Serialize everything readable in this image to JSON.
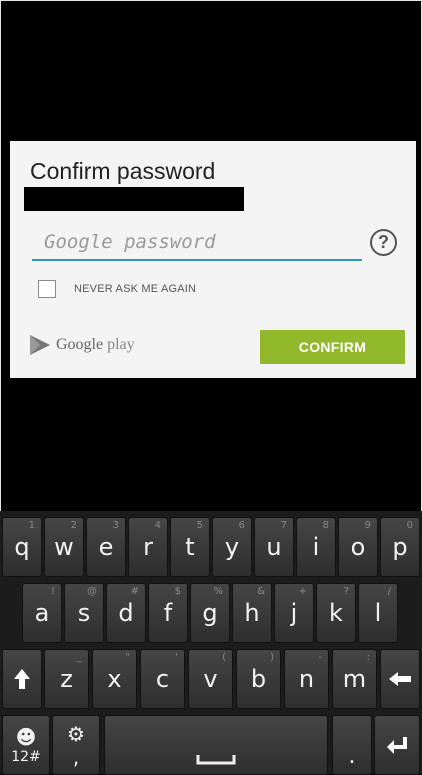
{
  "dialog": {
    "title": "Confirm password",
    "password_placeholder": "Google password",
    "help_symbol": "?",
    "never_ask_label": "NEVER ASK ME AGAIN",
    "brand_google": "Google",
    "brand_play": " play",
    "confirm_label": "CONFIRM"
  },
  "colors": {
    "accent_input": "#2a98b8",
    "confirm_button": "#92b82c"
  },
  "keyboard": {
    "row1": [
      {
        "k": "q",
        "h": "1"
      },
      {
        "k": "w",
        "h": "2"
      },
      {
        "k": "e",
        "h": "3"
      },
      {
        "k": "r",
        "h": "4"
      },
      {
        "k": "t",
        "h": "5"
      },
      {
        "k": "y",
        "h": "6"
      },
      {
        "k": "u",
        "h": "7"
      },
      {
        "k": "i",
        "h": "8"
      },
      {
        "k": "o",
        "h": "9"
      },
      {
        "k": "p",
        "h": "0"
      }
    ],
    "row2": [
      {
        "k": "a",
        "h": "!"
      },
      {
        "k": "s",
        "h": "@"
      },
      {
        "k": "d",
        "h": "#"
      },
      {
        "k": "f",
        "h": "$"
      },
      {
        "k": "g",
        "h": "%"
      },
      {
        "k": "h",
        "h": "&"
      },
      {
        "k": "j",
        "h": "+"
      },
      {
        "k": "k",
        "h": "?"
      },
      {
        "k": "l",
        "h": "/"
      }
    ],
    "row3": [
      {
        "k": "z",
        "h": "_"
      },
      {
        "k": "x",
        "h": "\""
      },
      {
        "k": "c",
        "h": "'"
      },
      {
        "k": "v",
        "h": "("
      },
      {
        "k": "b",
        "h": ")"
      },
      {
        "k": "n",
        "h": "-"
      },
      {
        "k": "m",
        "h": ":"
      }
    ],
    "shift_icon": "up-arrow-icon",
    "backspace_icon": "left-arrow-icon",
    "symbols_label": "12#",
    "emoji_icon": "smiley-icon",
    "settings_icon": "gear-icon",
    "comma_label": ",",
    "space_icon": "space-bar-icon",
    "period_label": ".",
    "enter_icon": "enter-arrow-icon"
  }
}
